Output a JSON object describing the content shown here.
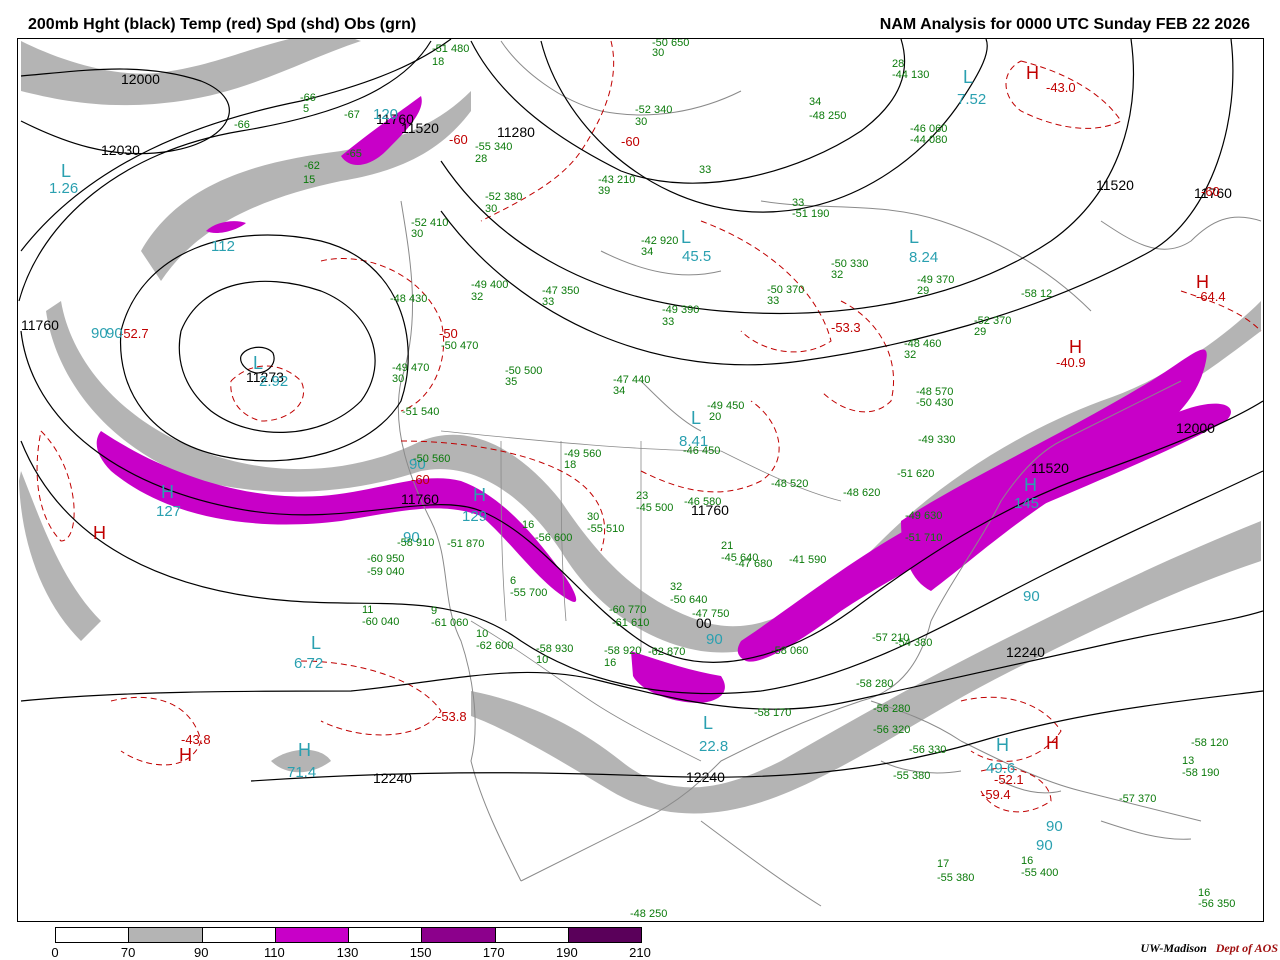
{
  "header": {
    "title_left": "200mb Hght (black) Temp (red) Spd (shd) Obs (grn)",
    "title_right": "NAM Analysis for 0000 UTC Sunday  FEB 22 2026"
  },
  "legend": {
    "ticks": [
      "0",
      "70",
      "90",
      "110",
      "130",
      "150",
      "170",
      "190",
      "210"
    ],
    "colors": [
      "#ffffff",
      "#b4b4b4",
      "#ffffff",
      "#c800c8",
      "#ffffff",
      "#8c008c",
      "#ffffff",
      "#5a005a"
    ]
  },
  "credit": {
    "org": "UW-Madison",
    "dept": "Dept of AOS"
  },
  "colors": {
    "height_contour": "#000000",
    "temperature_contour": "#c00000",
    "speed_70_90": "#b4b4b4",
    "speed_110_130": "#c800c8",
    "speed_label": "#2aa0b0",
    "obs": "#0a7a0a",
    "geography": "#8a8a8a"
  },
  "height_labels": [
    "12000",
    "12030",
    "11520",
    "11280",
    "11520",
    "11760",
    "11273",
    "11760",
    "11520",
    "11760",
    "12240",
    "12240",
    "12240",
    "12000",
    "11760",
    "11760",
    "00"
  ],
  "temperature_labels": [
    "H",
    "-43.0",
    "-60",
    "-50",
    "-60",
    "-60",
    "H",
    "-64.4",
    "-53.3",
    "H",
    "-40.9",
    "-43.8",
    "H",
    "-53.8",
    "H",
    "-52.1",
    "-59.4",
    "H",
    "-52.7",
    "-60",
    "-60",
    "-40"
  ],
  "speed_labels": [
    "L",
    "1.26",
    "112",
    "L",
    "7.52",
    "L",
    "45.5",
    "L",
    "8.24",
    "L",
    "2.92",
    "90",
    "120",
    "90",
    "H",
    "127",
    "H",
    "129",
    "90",
    "L",
    "8.41",
    "H",
    "145",
    "L",
    "6.72",
    "H",
    "71.4",
    "90",
    "90",
    "L",
    "22.8",
    "H",
    "49.6",
    "90",
    "90",
    "90"
  ],
  "obs_labels": [
    "-51 480",
    "18",
    "-50 650",
    "30",
    "-66",
    "5",
    "-67",
    "-66",
    "-65",
    "-62",
    "15",
    "-55 340",
    "28",
    "-52 380",
    "30",
    "-52 410",
    "30",
    "-49 400",
    "32",
    "-47 350",
    "33",
    "-48 430",
    "-50 470",
    "-50 500",
    "35",
    "-47 440",
    "34",
    "-49 470",
    "30",
    "-51 540",
    "-50 560",
    "-49 560",
    "18",
    "-49 450",
    "20",
    "-46 450",
    "-51 620",
    "-48 520",
    "-48 620",
    "-49 630",
    "-51 710",
    "-51 870",
    "-58 910",
    "-60 950",
    "-59 040",
    "11",
    "-60 040",
    "9",
    "-61 060",
    "10",
    "-62 600",
    "6",
    "-55 700",
    "16",
    "-56 600",
    "30",
    "-55 510",
    "23",
    "-45 500",
    "-46 580",
    "21",
    "-45 640",
    "-47 680",
    "32",
    "-50 640",
    "-41 590",
    "-60 770",
    "-47 750",
    "-61 610",
    "-62 870",
    "-58 930",
    "10",
    "-58 920",
    "16",
    "-58 060",
    "-58 170",
    "-57 210",
    "-58 280",
    "-56 280",
    "-56 320",
    "-56 330",
    "-55 380",
    "-57 370",
    "13",
    "-58 190",
    "-58 120",
    "-54 380",
    "17",
    "-55 380",
    "16",
    "-55 400",
    "16",
    "-56 350",
    "-48 250",
    "33",
    "-51 190",
    "28",
    "-44 130",
    "34",
    "-48 250",
    "-46 060",
    "-44 080",
    "33",
    "-43 210",
    "39",
    "-42 920",
    "34",
    "-52 340",
    "30",
    "-50 330",
    "32",
    "-49 370",
    "29",
    "-52 370",
    "29",
    "-50 370",
    "33",
    "-49 390",
    "33",
    "-48 460",
    "32",
    "-48 570",
    "-50 430",
    "-49 330",
    "-58 12"
  ],
  "map_geometry": {
    "grey_bands": [
      "M 20,40 C 60,60 120,80 170,70 C 230,60 260,40 330,30 L 360,40 C 300,60 250,90 180,100 C 110,110 60,100 20,90 Z",
      "M 140,250 C 180,180 260,160 340,150 C 400,140 440,120 470,90 L 470,110 C 440,150 400,170 340,180 C 270,195 200,220 160,280 Z",
      "M 60,300 C 70,360 120,420 200,450 C 280,480 360,470 420,440 C 470,420 520,450 560,500 C 600,560 640,600 700,620 C 760,640 820,600 880,540 C 940,480 1020,430 1100,400 C 1160,380 1220,340 1260,300 L 1260,330 C 1220,360 1170,400 1110,420 C 1030,450 950,500 890,560 C 830,620 770,660 700,650 C 640,640 590,600 560,550 C 520,490 470,460 420,470 C 360,490 280,500 200,480 C 110,450 55,380 45,310 Z",
      "M 20,470 C 40,520 60,580 100,620 L 80,640 C 40,600 20,540 18,480 Z",
      "M 470,690 C 520,700 570,720 620,760 C 670,800 720,790 780,760 C 850,720 920,680 1000,640 C 1080,600 1160,560 1260,520 L 1260,560 C 1170,590 1090,630 1010,670 C 930,710 860,760 790,790 C 720,820 660,820 610,790 C 560,760 510,730 470,715 Z",
      "M 270,760 C 290,745 320,745 330,760 C 310,775 285,775 270,760 Z"
    ],
    "magenta_bands": [
      "M 100,430 C 160,470 240,500 320,495 C 380,490 420,470 460,480 C 500,495 530,530 560,570 C 575,590 580,605 570,600 C 540,585 510,540 480,515 C 440,500 400,510 340,520 C 260,530 170,520 110,470 C 95,455 92,440 100,430 Z",
      "M 740,640 C 800,600 860,550 940,510 C 1020,470 1100,440 1180,410 C 1220,395 1240,405 1225,420 C 1180,445 1120,470 1050,500 C 980,530 900,570 840,610 C 800,640 760,665 745,660 C 735,655 735,648 740,640 Z",
      "M 900,520 C 960,480 1050,440 1150,380 C 1190,355 1210,335 1205,360 C 1195,410 1150,440 1080,480 C 1020,515 970,560 930,590 C 910,580 900,555 900,520 Z",
      "M 630,650 C 660,660 690,670 720,675 C 730,690 720,700 700,702 C 670,702 640,690 632,675 Z",
      "M 340,155 C 370,130 400,110 420,95 C 425,110 405,130 385,150 C 370,165 350,170 340,155 Z",
      "M 205,230 C 215,220 235,218 245,222 C 235,230 215,235 205,230 Z"
    ],
    "height_contours": [
      "M 20,75 C 80,70 140,60 200,80 C 250,100 230,140 170,150 C 110,160 60,140 20,120",
      "M 20,250 C 90,160 200,120 300,100 C 380,80 420,60 450,38",
      "M 18,300 C 40,220 120,150 240,130 C 330,115 400,90 430,40",
      "M 180,330 C 200,280 260,270 320,290 C 370,310 390,360 360,400 C 320,440 250,440 210,410 C 180,385 175,355 180,330",
      "M 240,355 C 245,345 265,343 272,352 C 276,362 268,372 255,372 C 245,370 238,362 240,355",
      "M 120,330 C 140,250 230,220 320,240 C 400,260 420,340 400,400 C 370,450 290,470 220,455 C 150,440 115,390 120,330",
      "M 20,330 C 30,420 120,490 250,510 C 350,525 430,490 480,510 C 540,535 580,600 640,640 C 700,680 780,660 850,610 C 930,550 1010,500 1100,470 C 1170,445 1230,420 1262,400",
      "M 20,440 C 60,540 160,590 290,600 C 380,607 450,590 520,640 C 580,680 660,700 760,690 C 860,675 950,620 1050,570 C 1140,525 1210,495 1262,470",
      "M 20,700 C 120,690 250,690 350,690 C 450,680 520,660 600,680 C 680,700 760,720 850,700 C 940,680 1030,660 1120,640 C 1190,625 1230,620 1262,610",
      "M 250,780 C 400,770 520,770 650,775 C 780,780 880,770 980,740 C 1080,710 1180,700 1262,690",
      "M 470,40 C 500,100 560,140 620,170 C 700,200 800,170 860,130 C 900,100 910,70 900,38",
      "M 540,40 C 560,120 640,200 740,210 C 840,220 920,160 960,100 C 980,70 990,50 985,38",
      "M 440,160 C 500,250 600,300 720,310 C 840,320 960,300 1050,240 C 1120,190 1140,110 1130,38",
      "M 440,210 C 520,320 660,380 800,360 C 940,340 1060,300 1150,250 C 1210,215 1240,120 1230,38"
    ],
    "temperature_contours": [
      "M 1020,60 C 1060,70 1100,90 1120,120 C 1090,135 1050,125 1020,110 C 1000,95 1000,70 1020,60",
      "M 40,430 C 80,470 80,540 60,540 C 40,520 30,480 40,430",
      "M 610,40 C 620,80 600,120 580,150 C 560,180 520,200 480,220",
      "M 700,220 C 780,250 820,300 830,340 C 800,360 760,350 740,330",
      "M 1180,290 C 1210,300 1240,310 1260,330",
      "M 110,700 C 150,690 190,700 200,740 C 190,770 150,770 120,750",
      "M 300,660 C 360,660 420,680 440,710 C 420,740 360,740 320,720",
      "M 640,470 C 680,490 720,500 760,480 C 790,460 780,420 750,400",
      "M 960,700 C 1000,690 1040,700 1060,730 C 1040,760 1000,770 970,750",
      "M 980,770 C 1020,760 1050,780 1050,800 C 1020,820 990,810 980,790",
      "M 230,380 C 250,360 280,360 300,380 C 310,400 290,420 260,420 C 240,415 228,400 230,380",
      "M 320,260 C 360,250 420,270 440,320 C 450,360 430,400 400,410",
      "M 400,440 C 460,440 520,450 560,470 C 600,490 610,520 600,550",
      "M 840,300 C 880,320 900,360 890,400 C 870,420 840,410 820,390"
    ],
    "coastlines": [
      "M 400,200 C 410,260 420,320 400,380 C 390,430 410,480 430,520 C 450,560 440,600 460,640 C 470,670 480,720 470,760 C 480,800 500,840 520,880",
      "M 520,880 C 560,860 600,840 640,820 C 680,800 700,780 720,760 C 760,740 800,720 860,700 C 900,690 920,660 930,620",
      "M 930,620 C 950,580 980,540 1000,500 C 1020,470 1040,450 1060,440",
      "M 1060,440 C 1100,420 1140,400 1180,380",
      "M 700,820 C 740,850 780,880 820,905",
      "M 870,700 C 900,710 930,720 960,740",
      "M 960,740 C 1000,760 1040,780 1080,790 C 1120,800 1160,810 1200,820",
      "M 500,40 C 520,70 560,100 600,110 C 650,120 700,110 740,90",
      "M 760,200 C 820,210 880,200 940,220 C 1000,240 1050,270 1090,310",
      "M 1100,220 C 1130,240 1160,260 1190,240 C 1210,220 1230,210 1260,220",
      "M 600,250 C 640,270 680,280 720,270",
      "M 640,380 C 660,400 680,420 700,430",
      "M 880,760 C 900,770 930,775 960,770",
      "M 1000,780 C 1020,790 1040,795 1060,790",
      "M 1100,820 C 1130,830 1160,840 1190,838"
    ],
    "borders": [
      "M 440,430 C 540,440 640,450 720,450",
      "M 720,450 C 760,470 800,490 840,500",
      "M 470,620 C 520,650 560,680 590,700 C 620,720 660,740 700,760",
      "M 560,440 C 560,500 560,560 565,620",
      "M 640,440 L 640,650",
      "M 500,440 C 500,500 500,560 505,620"
    ]
  },
  "map_labels": {
    "heights": [
      [
        120,
        83
      ],
      [
        100,
        154
      ],
      [
        1095,
        189
      ],
      [
        496,
        136
      ],
      [
        400,
        132
      ],
      [
        375,
        123
      ],
      [
        245,
        381
      ],
      [
        400,
        503
      ],
      [
        1030,
        472
      ],
      [
        690,
        514
      ],
      [
        1005,
        656
      ],
      [
        372,
        782
      ],
      [
        685,
        781
      ],
      [
        1175,
        432
      ],
      [
        1193,
        197
      ],
      [
        20,
        329
      ],
      [
        695,
        627
      ],
      [
        695,
        688
      ]
    ],
    "temps": [
      [
        1025,
        78
      ],
      [
        1045,
        91
      ],
      [
        620,
        145
      ],
      [
        438,
        337
      ],
      [
        448,
        143
      ],
      [
        410,
        483
      ],
      [
        1195,
        287
      ],
      [
        1195,
        300
      ],
      [
        830,
        331
      ],
      [
        1068,
        352
      ],
      [
        1055,
        366
      ],
      [
        180,
        743
      ],
      [
        178,
        760
      ],
      [
        436,
        720
      ],
      [
        1045,
        748
      ],
      [
        993,
        783
      ],
      [
        980,
        798
      ],
      [
        92,
        538
      ],
      [
        118,
        337
      ],
      [
        1200,
        195
      ]
    ],
    "speed": [
      [
        60,
        176
      ],
      [
        48,
        192
      ],
      [
        210,
        250
      ],
      [
        962,
        82
      ],
      [
        956,
        103
      ],
      [
        680,
        242
      ],
      [
        681,
        260
      ],
      [
        908,
        242
      ],
      [
        908,
        261
      ],
      [
        252,
        368
      ],
      [
        258,
        385
      ],
      [
        90,
        337
      ],
      [
        372,
        118
      ],
      [
        408,
        468
      ],
      [
        160,
        497
      ],
      [
        155,
        515
      ],
      [
        472,
        500
      ],
      [
        461,
        520
      ],
      [
        402,
        541
      ],
      [
        690,
        423
      ],
      [
        678,
        445
      ],
      [
        1023,
        490
      ],
      [
        1013,
        507
      ],
      [
        310,
        648
      ],
      [
        293,
        667
      ],
      [
        297,
        755
      ],
      [
        286,
        776
      ],
      [
        1022,
        600
      ],
      [
        705,
        643
      ],
      [
        702,
        728
      ],
      [
        698,
        750
      ],
      [
        995,
        750
      ],
      [
        985,
        772
      ],
      [
        1045,
        830
      ],
      [
        1035,
        849
      ],
      [
        105,
        337
      ]
    ],
    "obs": [
      [
        431,
        51
      ],
      [
        431,
        64
      ],
      [
        651,
        45
      ],
      [
        651,
        55
      ],
      [
        299,
        100
      ],
      [
        302,
        111
      ],
      [
        343,
        117
      ],
      [
        233,
        127
      ],
      [
        345,
        156
      ],
      [
        303,
        168
      ],
      [
        302,
        182
      ],
      [
        474,
        149
      ],
      [
        474,
        161
      ],
      [
        484,
        199
      ],
      [
        484,
        211
      ],
      [
        410,
        225
      ],
      [
        410,
        236
      ],
      [
        470,
        287
      ],
      [
        470,
        299
      ],
      [
        541,
        293
      ],
      [
        541,
        304
      ],
      [
        389,
        301
      ],
      [
        440,
        348
      ],
      [
        504,
        373
      ],
      [
        504,
        384
      ],
      [
        612,
        382
      ],
      [
        612,
        393
      ],
      [
        391,
        370
      ],
      [
        391,
        381
      ],
      [
        401,
        414
      ],
      [
        412,
        461
      ],
      [
        563,
        456
      ],
      [
        563,
        467
      ],
      [
        706,
        408
      ],
      [
        708,
        419
      ],
      [
        682,
        453
      ],
      [
        896,
        476
      ],
      [
        770,
        486
      ],
      [
        842,
        495
      ],
      [
        904,
        518
      ],
      [
        904,
        540
      ],
      [
        446,
        546
      ],
      [
        396,
        545
      ],
      [
        366,
        561
      ],
      [
        366,
        574
      ],
      [
        361,
        612
      ],
      [
        361,
        624
      ],
      [
        430,
        613
      ],
      [
        430,
        625
      ],
      [
        475,
        636
      ],
      [
        475,
        648
      ],
      [
        509,
        583
      ],
      [
        509,
        595
      ],
      [
        521,
        527
      ],
      [
        534,
        540
      ],
      [
        586,
        519
      ],
      [
        586,
        531
      ],
      [
        635,
        498
      ],
      [
        635,
        510
      ],
      [
        683,
        504
      ],
      [
        720,
        548
      ],
      [
        720,
        560
      ],
      [
        734,
        566
      ],
      [
        669,
        589
      ],
      [
        669,
        602
      ],
      [
        788,
        562
      ],
      [
        608,
        612
      ],
      [
        691,
        616
      ],
      [
        611,
        625
      ],
      [
        647,
        654
      ],
      [
        535,
        651
      ],
      [
        535,
        662
      ],
      [
        603,
        653
      ],
      [
        603,
        665
      ],
      [
        770,
        653
      ],
      [
        753,
        715
      ],
      [
        871,
        640
      ],
      [
        855,
        686
      ],
      [
        872,
        711
      ],
      [
        872,
        732
      ],
      [
        908,
        752
      ],
      [
        892,
        778
      ],
      [
        1118,
        801
      ],
      [
        1181,
        763
      ],
      [
        1181,
        775
      ],
      [
        1190,
        745
      ],
      [
        894,
        645
      ],
      [
        936,
        866
      ],
      [
        936,
        880
      ],
      [
        1020,
        863
      ],
      [
        1020,
        875
      ],
      [
        1197,
        895
      ],
      [
        1197,
        906
      ],
      [
        629,
        916
      ],
      [
        791,
        205
      ],
      [
        791,
        216
      ],
      [
        891,
        66
      ],
      [
        891,
        77
      ],
      [
        808,
        104
      ],
      [
        808,
        118
      ],
      [
        909,
        131
      ],
      [
        909,
        142
      ],
      [
        698,
        172
      ],
      [
        597,
        182
      ],
      [
        597,
        193
      ],
      [
        640,
        243
      ],
      [
        640,
        254
      ],
      [
        634,
        112
      ],
      [
        634,
        124
      ],
      [
        830,
        266
      ],
      [
        830,
        277
      ],
      [
        916,
        282
      ],
      [
        916,
        293
      ],
      [
        973,
        323
      ],
      [
        973,
        334
      ],
      [
        766,
        292
      ],
      [
        766,
        303
      ],
      [
        661,
        312
      ],
      [
        661,
        324
      ],
      [
        903,
        346
      ],
      [
        903,
        357
      ],
      [
        915,
        394
      ],
      [
        915,
        405
      ],
      [
        917,
        442
      ],
      [
        1020,
        296
      ],
      [
        1025,
        303
      ],
      [
        1233,
        737
      ]
    ]
  }
}
